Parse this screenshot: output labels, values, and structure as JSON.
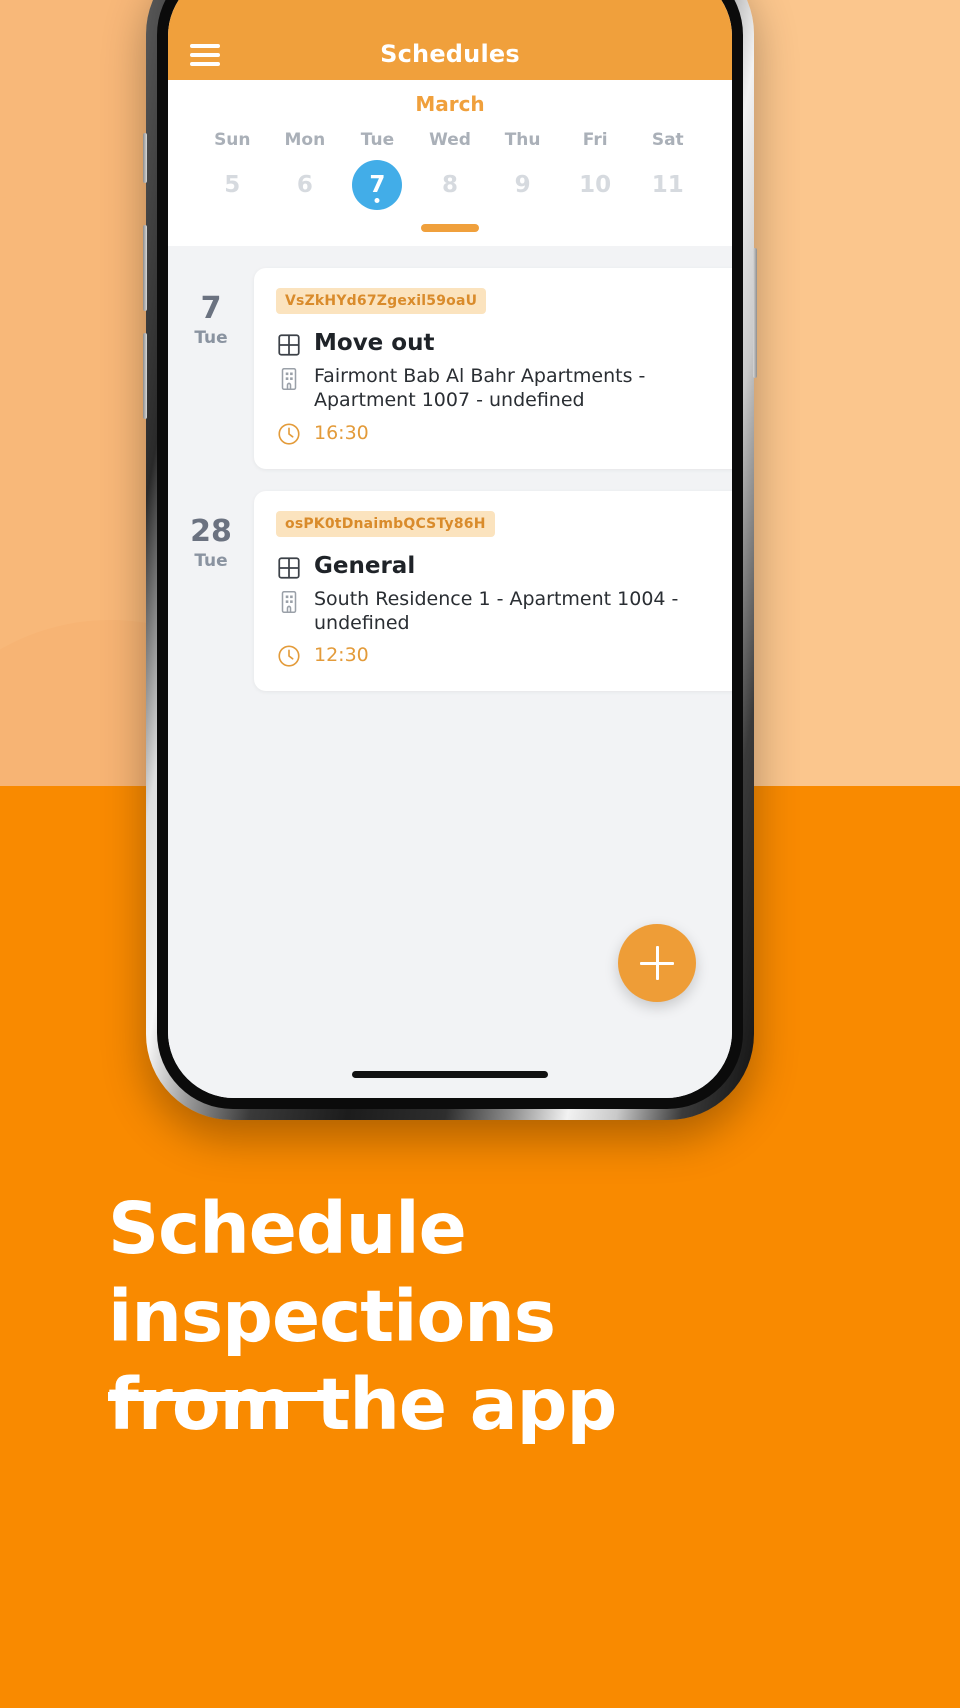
{
  "theme": {
    "brand_orange": "#F98A00",
    "appbar_orange": "#F0A03C",
    "accent_blue": "#42ADE8",
    "badge_bg": "#FBE3BE",
    "badge_text": "#D98B2B",
    "screen_bg": "#F2F3F5",
    "bg_peach": "#FBC68D",
    "bg_tan": "#D79A55"
  },
  "appbar": {
    "title": "Schedules",
    "menu_icon": "hamburger-icon"
  },
  "calendar": {
    "month": "March",
    "days": [
      {
        "dow": "Sun",
        "num": "5",
        "selected": false
      },
      {
        "dow": "Mon",
        "num": "6",
        "selected": false
      },
      {
        "dow": "Tue",
        "num": "7",
        "selected": true
      },
      {
        "dow": "Wed",
        "num": "8",
        "selected": false
      },
      {
        "dow": "Thu",
        "num": "9",
        "selected": false
      },
      {
        "dow": "Fri",
        "num": "10",
        "selected": false
      },
      {
        "dow": "Sat",
        "num": "11",
        "selected": false
      }
    ]
  },
  "schedules": [
    {
      "day_number": "7",
      "day_name": "Tue",
      "badge": "VsZkHYd67Zgexil59oaU",
      "type": "Move out",
      "location": "Fairmont Bab Al Bahr Apartments - Apartment 1007 - undefined",
      "time": "16:30",
      "type_icon": "grid-icon",
      "location_icon": "building-icon",
      "time_icon": "clock-icon"
    },
    {
      "day_number": "28",
      "day_name": "Tue",
      "badge": "osPK0tDnaimbQCSTy86H",
      "type": "General",
      "location": "South Residence 1 - Apartment 1004 - undefined",
      "time": "12:30",
      "type_icon": "grid-icon",
      "location_icon": "building-icon",
      "time_icon": "clock-icon"
    }
  ],
  "fab": {
    "icon": "plus-icon",
    "label": "+"
  },
  "promo": {
    "headline_line1": "Schedule inspections",
    "headline_line2": "from the app"
  }
}
